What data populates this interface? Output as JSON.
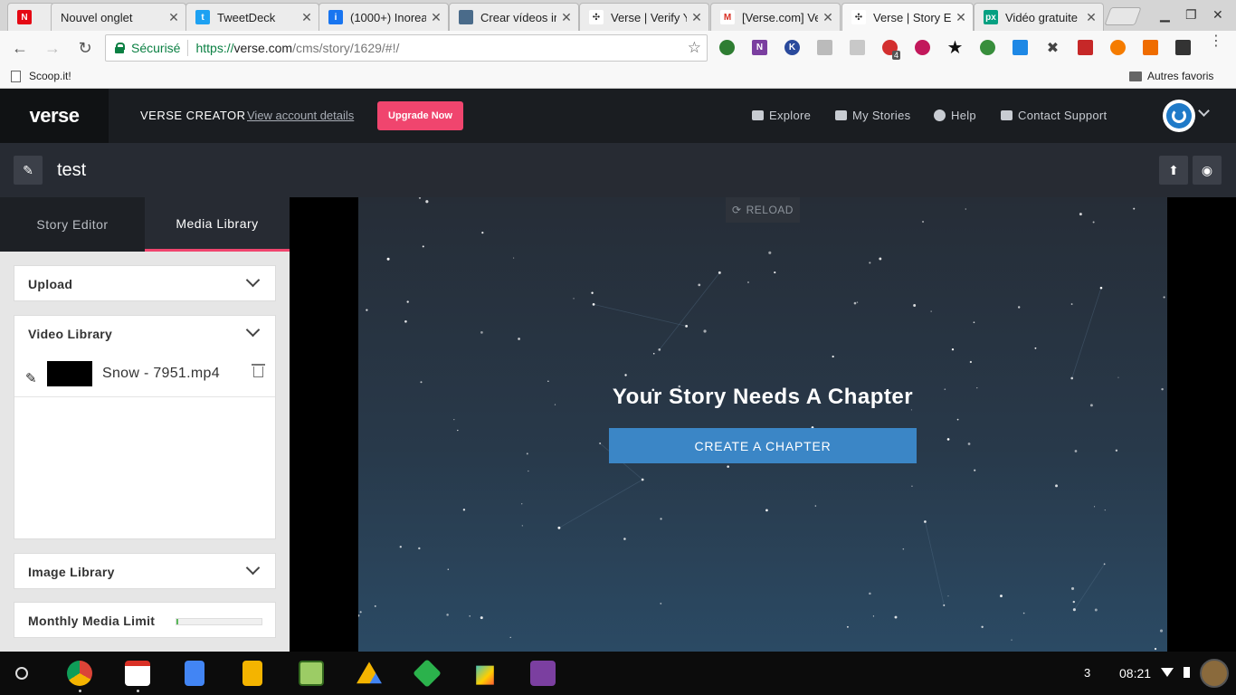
{
  "browser": {
    "tabs": [
      {
        "label": "",
        "favicon": "netflix-icon",
        "color": "#e50914",
        "glyph": "N"
      },
      {
        "label": "Nouvel onglet",
        "favicon": "",
        "color": "",
        "glyph": ""
      },
      {
        "label": "TweetDeck",
        "favicon": "tweetdeck-icon",
        "color": "#1da1f2",
        "glyph": "t"
      },
      {
        "label": "(1000+) Inorea",
        "favicon": "inoreader-icon",
        "color": "#1875f0",
        "glyph": "i"
      },
      {
        "label": "Crear vídeos in",
        "favicon": "video-site-icon",
        "color": "#4a6b8a",
        "glyph": ""
      },
      {
        "label": "Verse | Verify Y",
        "favicon": "verse-icon",
        "color": "#222",
        "glyph": "v"
      },
      {
        "label": "[Verse.com] Ve",
        "favicon": "gmail-icon",
        "color": "#d93025",
        "glyph": "M"
      },
      {
        "label": "Verse | Story E",
        "favicon": "verse-icon",
        "color": "#222",
        "glyph": "v"
      },
      {
        "label": "Vidéo gratuite",
        "favicon": "pexels-icon",
        "color": "#05a081",
        "glyph": "px"
      }
    ],
    "omnibox": {
      "secure_label": "Sécurisé",
      "url_scheme": "https://",
      "url_host": "verse.com",
      "url_path": "/cms/story/1629/#!/"
    },
    "extension_badge": "4",
    "bookmarks": {
      "left": "Scoop.it!",
      "right": "Autres favoris"
    }
  },
  "app": {
    "logo": "verse",
    "title": "VERSE CREATOR",
    "account_link": "View account details",
    "upgrade_button": "Upgrade Now",
    "nav": [
      {
        "label": "Explore",
        "icon": "youtube-icon"
      },
      {
        "label": "My Stories",
        "icon": "stack-icon"
      },
      {
        "label": "Help",
        "icon": "question-icon"
      },
      {
        "label": "Contact Support",
        "icon": "envelope-icon"
      }
    ]
  },
  "story": {
    "title": "test"
  },
  "sidebar": {
    "tabs": [
      {
        "label": "Story Editor",
        "active": false
      },
      {
        "label": "Media Library",
        "active": true
      }
    ],
    "panels": {
      "upload": "Upload",
      "video_library": "Video Library",
      "image_library": "Image Library",
      "monthly_limit": "Monthly Media Limit"
    },
    "videos": [
      {
        "filename": "Snow - 7951.mp4"
      }
    ],
    "monthly_limit_used_fraction": 0.02
  },
  "preview": {
    "reload_label": "RELOAD",
    "heading": "Your Story Needs A Chapter",
    "cta": "CREATE A CHAPTER"
  },
  "taskbar": {
    "apps": [
      "chrome-icon",
      "gmail-icon",
      "docs-icon",
      "slides-icon",
      "app-icon",
      "drive-icon",
      "feedly-icon",
      "play-store-icon",
      "onenote-icon"
    ],
    "notification_count": "3",
    "time": "08:21"
  },
  "colors": {
    "accent_pink": "#f0456e",
    "cta_blue": "#3b86c6",
    "secure_green": "#0b8043"
  }
}
